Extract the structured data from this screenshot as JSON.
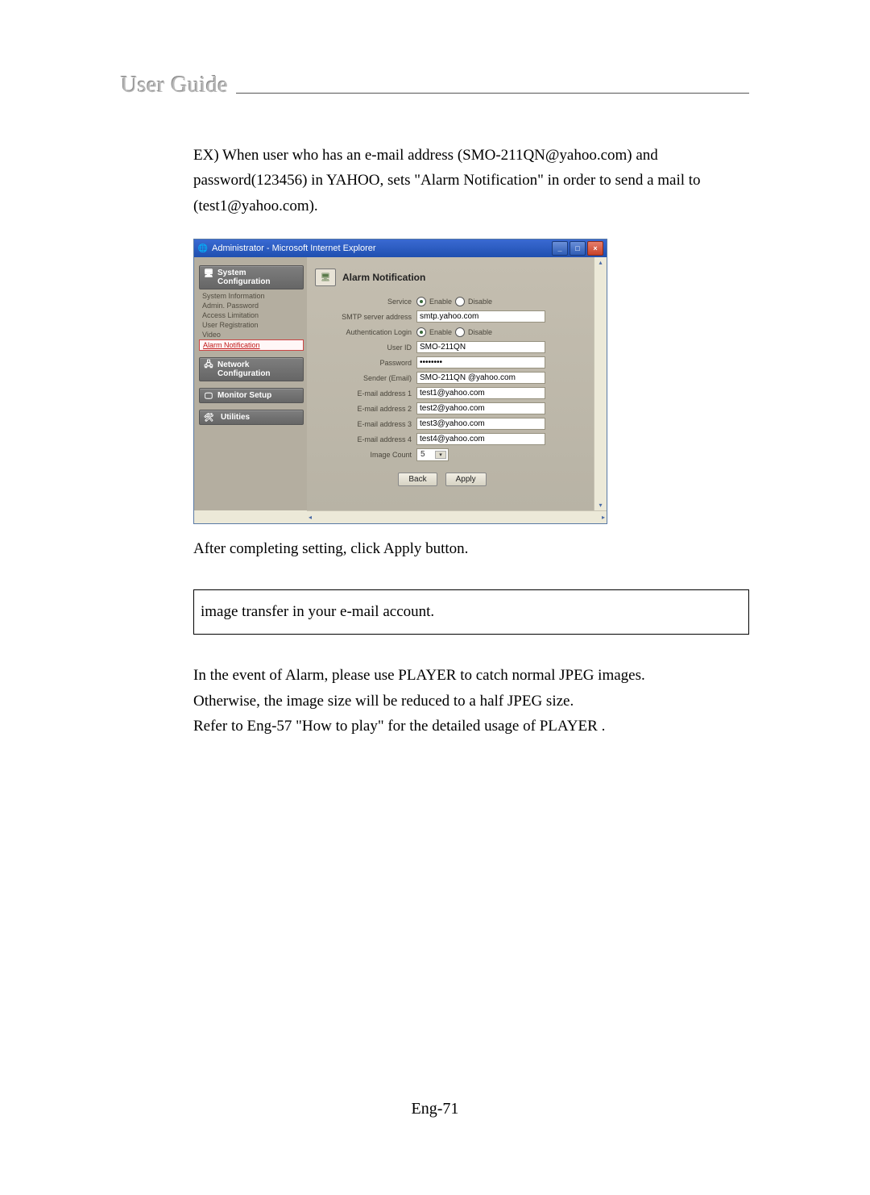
{
  "header": {
    "title": "User Guide"
  },
  "intro": {
    "p1a": "EX) When user who has an e-mail address (SMO-211QN@yahoo.com) and",
    "p1b": "password(123456) in YAHOO, sets \"Alarm Notification\" in order to send a mail to",
    "p1c": "(test1@yahoo.com)."
  },
  "window": {
    "title": "Administrator - Microsoft Internet Explorer",
    "sidebar": {
      "cat1": "System Configuration",
      "links": [
        "System Information",
        "Admin. Password",
        "Access Limitation",
        "User Registration",
        "Video",
        "Alarm Notification"
      ],
      "cat2": "Network Configuration",
      "cat3": "Monitor Setup",
      "cat4": "Utilities"
    },
    "panel": {
      "title": "Alarm Notification",
      "rows": {
        "service_lbl": "Service",
        "smtp_lbl": "SMTP server address",
        "smtp_val": "smtp.yahoo.com",
        "auth_lbl": "Authentication Login",
        "uid_lbl": "User ID",
        "uid_val": "SMO-211QN",
        "pwd_lbl": "Password",
        "pwd_val": "••••••••",
        "sender_lbl": "Sender (Email)",
        "sender_val": "SMO-211QN @yahoo.com",
        "e1_lbl": "E-mail address 1",
        "e1_val": "test1@yahoo.com",
        "e2_lbl": "E-mail address 2",
        "e2_val": "test2@yahoo.com",
        "e3_lbl": "E-mail address 3",
        "e3_val": "test3@yahoo.com",
        "e4_lbl": "E-mail address 4",
        "e4_val": "test4@yahoo.com",
        "imgcnt_lbl": "Image Count",
        "imgcnt_val": "5",
        "enable": "Enable",
        "disable": "Disable"
      },
      "buttons": {
        "back": "Back",
        "apply": "Apply"
      }
    }
  },
  "after": {
    "p1": "After completing setting, click Apply button.",
    "box": "image transfer in your e-mail account.",
    "p2a": "In the event of Alarm, please use PLAYER to catch normal JPEG images.",
    "p2b": "Otherwise, the image size will be reduced to a half JPEG size.",
    "p2c": "Refer to Eng-57 \"How to play\" for the detailed usage of PLAYER ."
  },
  "page_number": "Eng-71"
}
